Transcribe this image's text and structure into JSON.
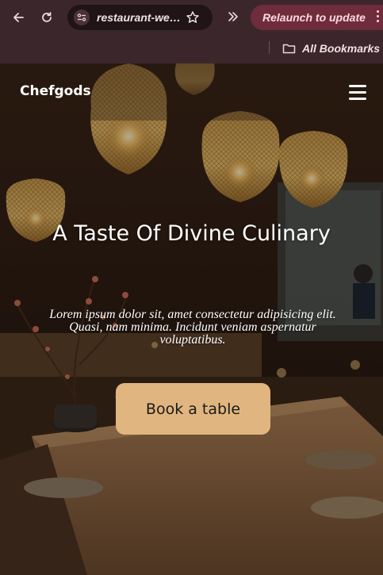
{
  "browser": {
    "url": "restaurant-website",
    "relaunch_label": "Relaunch to update",
    "bookmarks_label": "All Bookmarks",
    "icons": [
      "back-arrow-icon",
      "reload-icon",
      "site-settings-icon",
      "star-icon",
      "chevron-double-right-icon",
      "more-vertical-icon",
      "folder-icon"
    ]
  },
  "site": {
    "logo": "Chefgods",
    "menu_icon": "hamburger-menu-icon"
  },
  "hero": {
    "title": "A Taste Of Divine Culinary",
    "text": "Lorem ipsum dolor sit, amet consectetur adipisicing elit. Quasi, nam minima. Incidunt veniam aspernatur voluptatibus.",
    "button_label": "Book a table",
    "background": "restaurant interior with woven pendant lamps"
  },
  "colors": {
    "chrome": "#3b272b",
    "relaunch_bg": "#6e2c3c",
    "button_bg": "#e1b57f"
  }
}
